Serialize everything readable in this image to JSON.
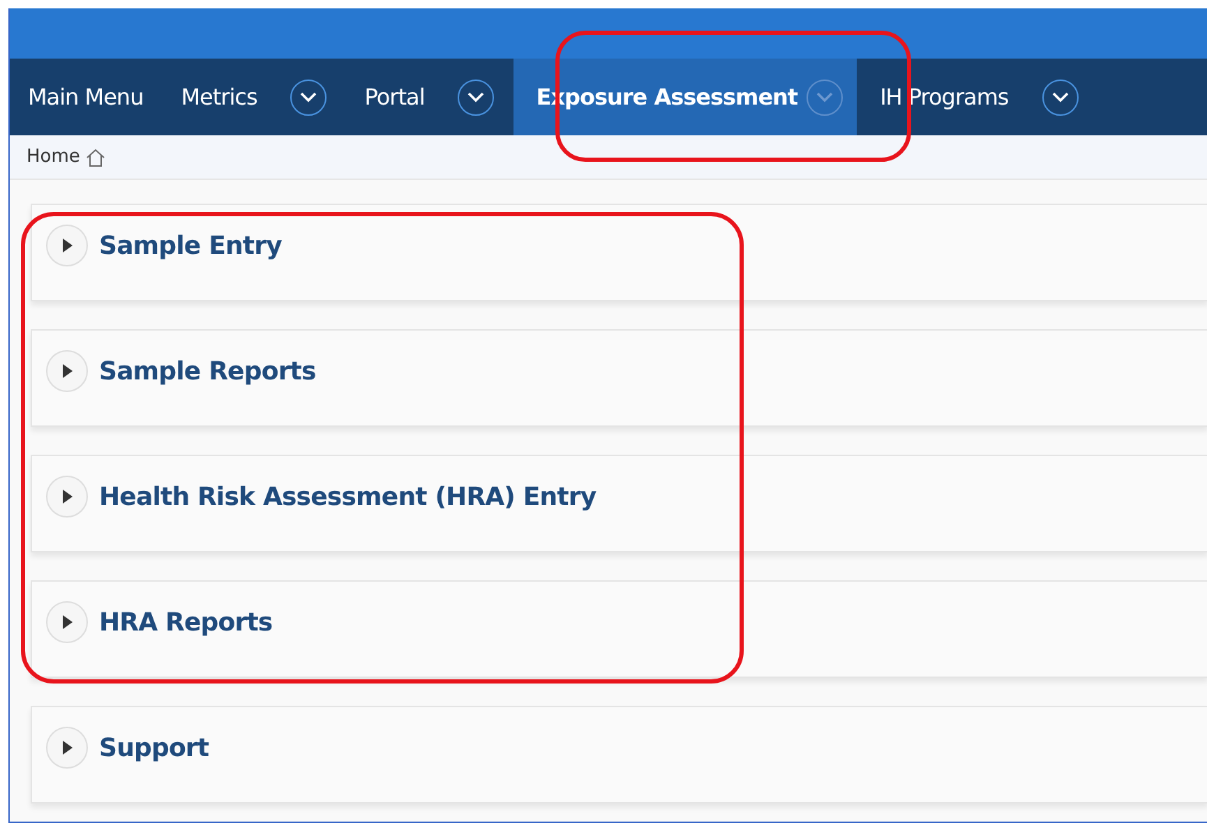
{
  "nav": [
    {
      "label": "Main Menu",
      "has_menu": false,
      "selected": false
    },
    {
      "label": "Metrics",
      "has_menu": true,
      "selected": false
    },
    {
      "label": "Portal",
      "has_menu": true,
      "selected": false
    },
    {
      "label": "Exposure Assessment",
      "has_menu": true,
      "selected": true
    },
    {
      "label": "IH Programs",
      "has_menu": true,
      "selected": false
    }
  ],
  "breadcrumb": {
    "label": "Home"
  },
  "sections": [
    {
      "title": "Sample Entry",
      "expanded": false
    },
    {
      "title": "Sample Reports",
      "expanded": false
    },
    {
      "title": "Health Risk Assessment (HRA) Entry",
      "expanded": false
    },
    {
      "title": "HRA Reports",
      "expanded": false
    },
    {
      "title": "Support",
      "expanded": false
    }
  ]
}
